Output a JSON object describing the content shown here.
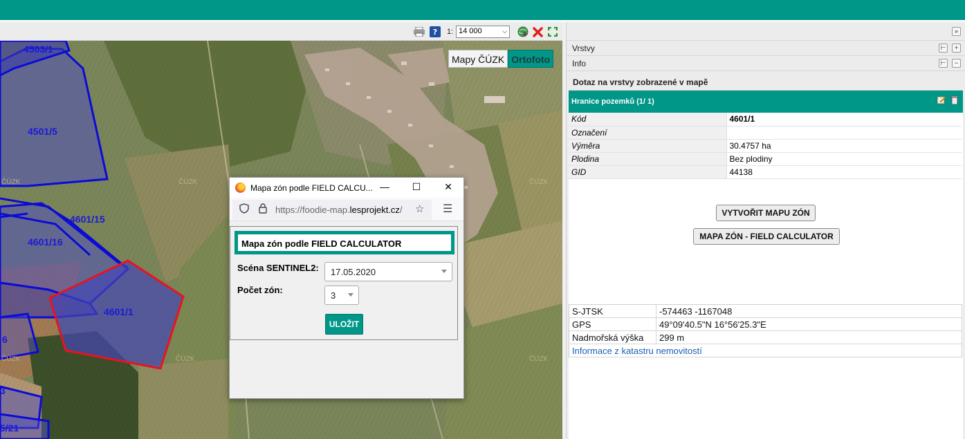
{
  "colors": {
    "accent": "#009688",
    "parcel_stroke": "#0b0bd6",
    "parcel_selected": "#e8141e"
  },
  "map_toolbar": {
    "icons": [
      "print-icon",
      "help-icon",
      "globe-icon",
      "close-icon",
      "fullscreen-icon"
    ],
    "scale_prefix": "1:",
    "scale_value": "14 000"
  },
  "layer_switch": {
    "cuzk": "Mapy ČÚZK",
    "orto": "Ortofoto"
  },
  "parcels": [
    "4503/1",
    "4501/5",
    "4601/15",
    "4601/16",
    "4601/1",
    "6",
    "3",
    "5/21"
  ],
  "watermark": "ČÚZK",
  "popup": {
    "window_title": "Mapa zón podle FIELD CALCU...",
    "url_prefix": "https://foodie-map.",
    "url_domain": "lesprojekt.cz",
    "url_suffix": "/",
    "heading": "Mapa zón podle FIELD CALCULATOR",
    "scene_label": "Scéna SENTINEL2:",
    "scene_value": "17.05.2020",
    "zones_label": "Počet zón:",
    "zones_value": "3",
    "save_label": "ULOŽIT"
  },
  "panel": {
    "vrstvy": "Vrstvy",
    "info": "Info",
    "query_title": "Dotaz na vrstvy zobrazené v mapě",
    "layer_title": "Hranice pozemků (1/ 1)",
    "attributes": [
      {
        "key": "Kód",
        "value": "4601/1"
      },
      {
        "key": "Označení",
        "value": ""
      },
      {
        "key": "Výměra",
        "value": "30.4757 ha"
      },
      {
        "key": "Plodina",
        "value": "Bez plodiny"
      },
      {
        "key": "GID",
        "value": "44138"
      }
    ],
    "btn_create_zone_map": "VYTVOŘIT MAPU ZÓN",
    "btn_field_calculator": "MAPA ZÓN - FIELD CALCULATOR",
    "coords": [
      {
        "key": "S-JTSK",
        "value": "-574463 -1167048"
      },
      {
        "key": "GPS",
        "value": "49°09'40.5\"N 16°56'25.3\"E"
      },
      {
        "key": "Nadmořská výška",
        "value": "299 m"
      }
    ],
    "cadastre_link": "Informace z katastru nemovitostí"
  }
}
